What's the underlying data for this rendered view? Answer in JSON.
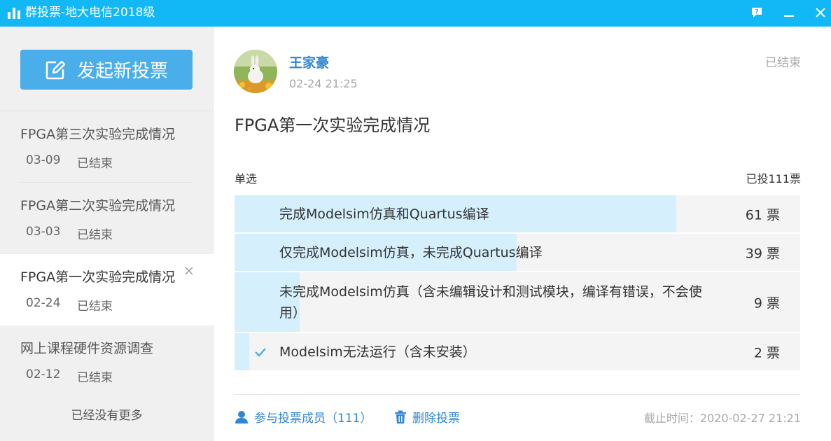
{
  "window": {
    "title": "群投票-地大电信2018级",
    "icons": [
      "bar-chart-icon",
      "feedback-icon",
      "minimize-icon",
      "close-icon"
    ],
    "accent": "#12b7f5"
  },
  "sidebar": {
    "new_vote_label": "发起新投票",
    "items": [
      {
        "title": "FPGA第三次实验完成情况",
        "date": "03-09",
        "status": "已结束"
      },
      {
        "title": "FPGA第二次实验完成情况",
        "date": "03-03",
        "status": "已结束"
      },
      {
        "title": "FPGA第一次实验完成情况",
        "date": "02-24",
        "status": "已结束"
      },
      {
        "title": "网上课程硬件资源调查",
        "date": "02-12",
        "status": "已结束"
      }
    ],
    "no_more": "已经没有更多"
  },
  "detail": {
    "author": "王家豪",
    "time": "02-24 21:25",
    "status": "已结束",
    "title": "FPGA第一次实验完成情况",
    "type": "单选",
    "total": "已投111票",
    "options": [
      {
        "label": "完成Modelsim仿真和Quartus编译",
        "count": "61 票",
        "votes": 61,
        "selected": false
      },
      {
        "label": "仅完成Modelsim仿真，未完成Quartus编译",
        "count": "39 票",
        "votes": 39,
        "selected": false
      },
      {
        "label": "未完成Modelsim仿真（含未编辑设计和测试模块，编译有错误，不会使用）",
        "count": "9 票",
        "votes": 9,
        "selected": false
      },
      {
        "label": "Modelsim无法运行（含未安装）",
        "count": "2 票",
        "votes": 2,
        "selected": true
      }
    ],
    "total_votes": 111,
    "members_link": "参与投票成员（111）",
    "delete_link": "删除投票",
    "deadline": "截止时间：2020-02-27 21:21",
    "bar_color": "#d5effd",
    "link_color": "#2f86d4"
  }
}
